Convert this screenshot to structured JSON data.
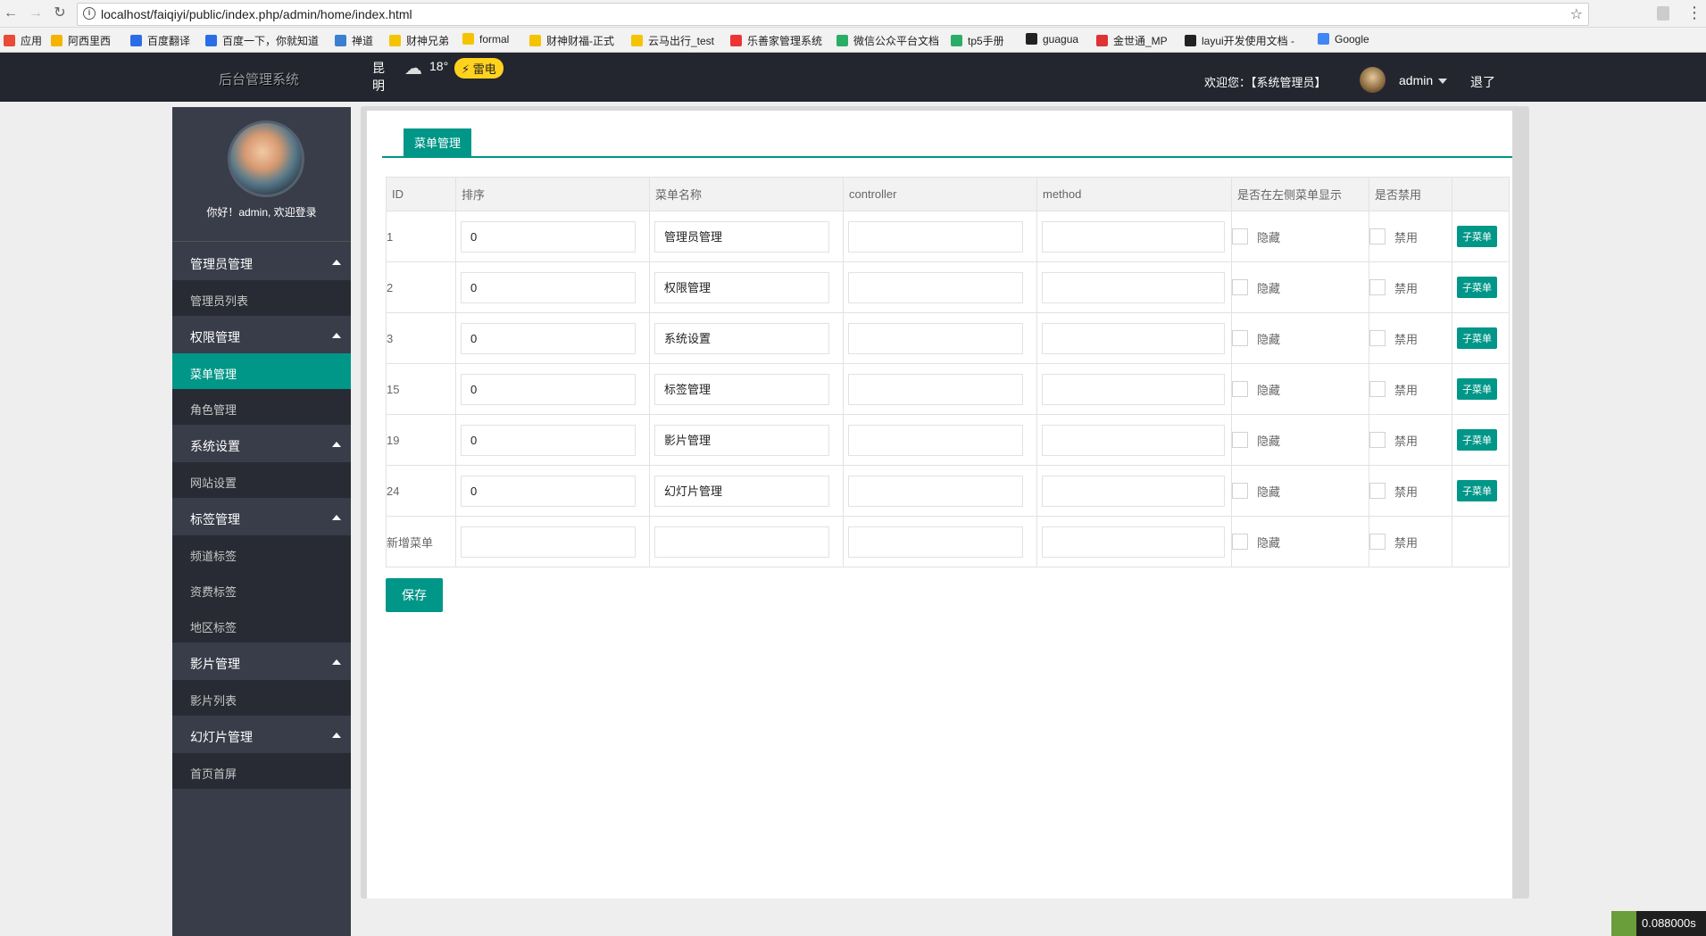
{
  "browser": {
    "url": "localhost/faiqiyi/public/index.php/admin/home/index.html",
    "bookmarks": [
      {
        "label": "应用",
        "color": "#e94b35"
      },
      {
        "label": "阿西里西",
        "color": "#f5b400"
      },
      {
        "label": "百度翻译",
        "color": "#2b6de6"
      },
      {
        "label": "百度一下，你就知道",
        "color": "#2b6de6"
      },
      {
        "label": "禅道",
        "color": "#3b7fd0"
      },
      {
        "label": "财神兄弟",
        "color": "#f5c400"
      },
      {
        "label": "formal",
        "color": "#f5c400"
      },
      {
        "label": "财神财福-正式",
        "color": "#f5c400"
      },
      {
        "label": "云马出行_test",
        "color": "#f5c400"
      },
      {
        "label": "乐善家管理系统",
        "color": "#e33"
      },
      {
        "label": "微信公众平台文档",
        "color": "#2aae67"
      },
      {
        "label": "tp5手册",
        "color": "#2aae67"
      },
      {
        "label": "guagua",
        "color": "#222"
      },
      {
        "label": "金世通_MP",
        "color": "#d33"
      },
      {
        "label": "layui开发使用文档 -",
        "color": "#222"
      },
      {
        "label": "Google",
        "color": "#4285f4"
      }
    ]
  },
  "header": {
    "logo": "后台管理系统",
    "city": "昆明",
    "temp": "18°",
    "alert": "⚡ 雷电",
    "welcome": "欢迎您：【系统管理员】",
    "user": "admin",
    "logout": "退了"
  },
  "sidebar": {
    "greeting": "你好！admin, 欢迎登录",
    "groups": [
      {
        "label": "管理员管理",
        "items": [
          "管理员列表"
        ]
      },
      {
        "label": "权限管理",
        "items": [
          "菜单管理",
          "角色管理"
        ]
      },
      {
        "label": "系统设置",
        "items": [
          "网站设置"
        ]
      },
      {
        "label": "标签管理",
        "items": [
          "频道标签",
          "资费标签",
          "地区标签"
        ]
      },
      {
        "label": "影片管理",
        "items": [
          "影片列表"
        ]
      },
      {
        "label": "幻灯片管理",
        "items": [
          "首页首屏"
        ]
      }
    ],
    "active_item": "菜单管理"
  },
  "main": {
    "tab": "菜单管理",
    "columns": [
      "ID",
      "排序",
      "菜单名称",
      "controller",
      "method",
      "是否在左侧菜单显示",
      "是否禁用",
      ""
    ],
    "rows": [
      {
        "id": "1",
        "sort": "0",
        "name": "管理员管理",
        "controller": "",
        "method": ""
      },
      {
        "id": "2",
        "sort": "0",
        "name": "权限管理",
        "controller": "",
        "method": ""
      },
      {
        "id": "3",
        "sort": "0",
        "name": "系统设置",
        "controller": "",
        "method": ""
      },
      {
        "id": "15",
        "sort": "0",
        "name": "标签管理",
        "controller": "",
        "method": ""
      },
      {
        "id": "19",
        "sort": "0",
        "name": "影片管理",
        "controller": "",
        "method": ""
      },
      {
        "id": "24",
        "sort": "0",
        "name": "幻灯片管理",
        "controller": "",
        "method": ""
      }
    ],
    "new_row_label": "新增菜单",
    "hide_label": "隐藏",
    "disable_label": "禁用",
    "submenu_label": "子菜单",
    "save_label": "保存"
  },
  "timer": "0.088000s",
  "colors": {
    "accent": "#009688",
    "header_bg": "#23262e",
    "sidebar_bg": "#393d49"
  }
}
